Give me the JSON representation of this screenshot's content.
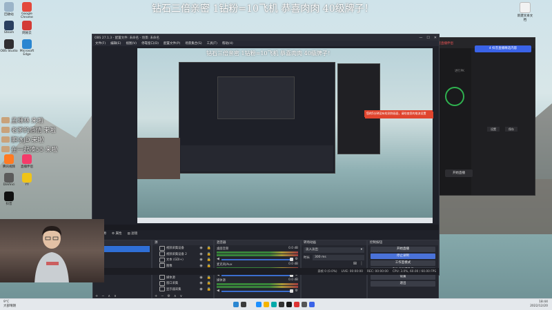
{
  "overlay_title": "钻石三倍亲密 1钻粉=10飞机  恭喜肉肉 40级牌子！",
  "preview_overlay_title": "钻石三倍亲密 1钻粉=10飞机  恭喜肉肉 40级牌子！",
  "chat": [
    {
      "name": "孟珊林",
      "msg": "来啦"
    },
    {
      "name": "老爹的感情",
      "msg": "来啦"
    },
    {
      "name": "鹏冰JD",
      "msg": "来啦"
    },
    {
      "name": "在一起凑55",
      "msg": "来啦"
    }
  ],
  "desktop_icons": [
    {
      "label": "回收站",
      "color": "#9bb4c8"
    },
    {
      "label": "Google Chrome",
      "color": "#e3483b"
    },
    {
      "label": "Steam",
      "color": "#2a3f5f"
    },
    {
      "label": "网易云",
      "color": "#d33b35"
    },
    {
      "label": "OBS Studio",
      "color": "#302e31"
    },
    {
      "label": "Microsoft Edge",
      "color": "#2a86d1"
    },
    {
      "label": "腾讯视频",
      "color": "#ff7b23"
    },
    {
      "label": "直播伴侣",
      "color": "#f43b6a"
    },
    {
      "label": "DaVinci",
      "color": "#5b5b5b"
    },
    {
      "label": "YY",
      "color": "#f0c419"
    },
    {
      "label": "抖音",
      "color": "#111111"
    }
  ],
  "desktop_icon_right": {
    "label": "新建文本文档",
    "color": "#f2f2f2"
  },
  "obs": {
    "window_title": "OBS 27.1.3 - 配置文件: 未命名 - 场景: 未命名",
    "menu": [
      "文件(F)",
      "编辑(E)",
      "视图(V)",
      "停靠窗口(D)",
      "配置文件(P)",
      "场景集合(S)",
      "工具(T)",
      "帮助(H)"
    ],
    "status_left": "不活跃",
    "docks": {
      "scenes": "场景",
      "sources": "源",
      "mixer": "混音器",
      "transitions": "转场动画",
      "controls": "控制按钮"
    },
    "scene_label": "未选择源",
    "properties_btn": "属性",
    "filters_btn": "滤镜",
    "scenes": [
      "场景"
    ],
    "sources": [
      "视频采集设备",
      "视频采集设备 2",
      "文本 (GDI+)",
      "图像",
      "颜色源",
      "媒体源",
      "窗口采集",
      "显示器采集"
    ],
    "mixer": [
      {
        "name": "桌面音频",
        "level": "0.0 dB"
      },
      {
        "name": "麦克风/Aux",
        "level": "0.0 dB"
      },
      {
        "name": "媒体源",
        "level": "0.0 dB"
      }
    ],
    "transition": {
      "type": "淡入淡出",
      "duration_label": "时长",
      "duration": "300 ms"
    },
    "controls": [
      "开始直播",
      "停止录制",
      "工作室模式",
      "启动虚拟摄像机",
      "设置",
      "退出"
    ],
    "active_control": "停止录制",
    "statusbar": [
      "丢帧 0 (0.0%)",
      "LIVE: 00:00:00",
      "REC: 00:00:00",
      "CPU: 3.0%, 60.00 / 60.00 FPS"
    ]
  },
  "right_app": {
    "brand": "抖音直播伴侣",
    "promo": "4 抖音直播精选内容",
    "pk_label": "进行PK",
    "start_live": "开始直播",
    "settings": "设置",
    "save": "保存"
  },
  "toast": "您的5分钟没有检测到画面，请检查您的推流设置",
  "taskbar": {
    "weather_temp": "9°C",
    "weather_desc": "大部晴朗",
    "time": "18:44",
    "date": "2022/12/20"
  },
  "colors": {
    "obs_bg": "#1f2129",
    "accent": "#4a72d8",
    "meter_green": "#3d9b3d",
    "toast_red": "#e0452e"
  }
}
